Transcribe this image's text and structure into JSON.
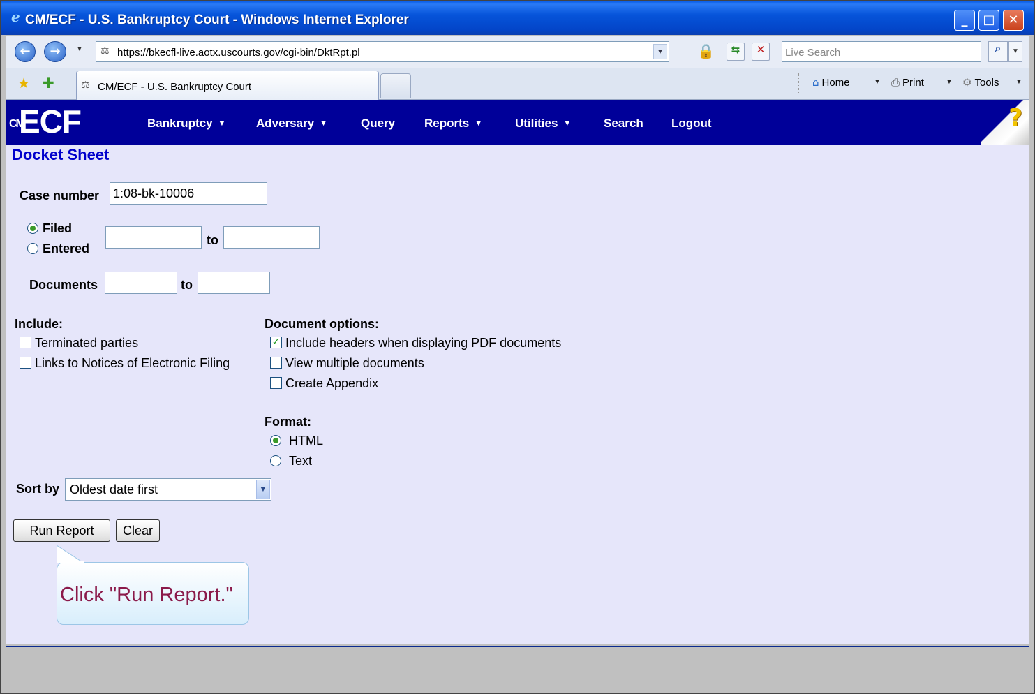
{
  "window": {
    "title": "CM/ECF - U.S. Bankruptcy Court - Windows Internet Explorer",
    "controls": {
      "minimize": "_",
      "maximize": "□",
      "close": "✕"
    }
  },
  "toolbar": {
    "url": "https://bkecfl-live.aotx.uscourts.gov/cgi-bin/DktRpt.pl",
    "search_placeholder": "Live Search",
    "back_glyph": "←",
    "forward_glyph": "→"
  },
  "tabs": {
    "active_tab_label": "CM/ECF - U.S. Bankruptcy Court",
    "home_label": "Home",
    "print_label": "Print",
    "tools_label": "Tools"
  },
  "nav": {
    "logo": "ECF",
    "logo_prefix": "CM",
    "help_glyph": "?",
    "items": [
      {
        "label": "Bankruptcy",
        "dropdown": true
      },
      {
        "label": "Adversary",
        "dropdown": true
      },
      {
        "label": "Query",
        "dropdown": false
      },
      {
        "label": "Reports",
        "dropdown": true
      },
      {
        "label": "Utilities",
        "dropdown": true
      },
      {
        "label": "Search",
        "dropdown": false
      },
      {
        "label": "Logout",
        "dropdown": false
      }
    ]
  },
  "form": {
    "page_title": "Docket Sheet",
    "case_number_label": "Case number",
    "case_number_value": "1:08-bk-10006",
    "filed_label": "Filed",
    "entered_label": "Entered",
    "date_to_label": "to",
    "documents_label": "Documents",
    "documents_to_label": "to",
    "include_header": "Include:",
    "include_options": [
      {
        "label": "Terminated parties",
        "checked": false
      },
      {
        "label": "Links to Notices of Electronic Filing",
        "checked": false
      }
    ],
    "document_options_header": "Document options:",
    "document_options": [
      {
        "label": "Include headers when displaying PDF documents",
        "checked": true
      },
      {
        "label": "View multiple documents",
        "checked": false
      },
      {
        "label": "Create Appendix",
        "checked": false
      }
    ],
    "format_header": "Format:",
    "format_html": "HTML",
    "format_text": "Text",
    "sort_by_label": "Sort by",
    "sort_by_value": "Oldest date first",
    "run_report_label": "Run Report",
    "clear_label": "Clear"
  },
  "callout": {
    "text": "Click \"Run Report.\""
  }
}
